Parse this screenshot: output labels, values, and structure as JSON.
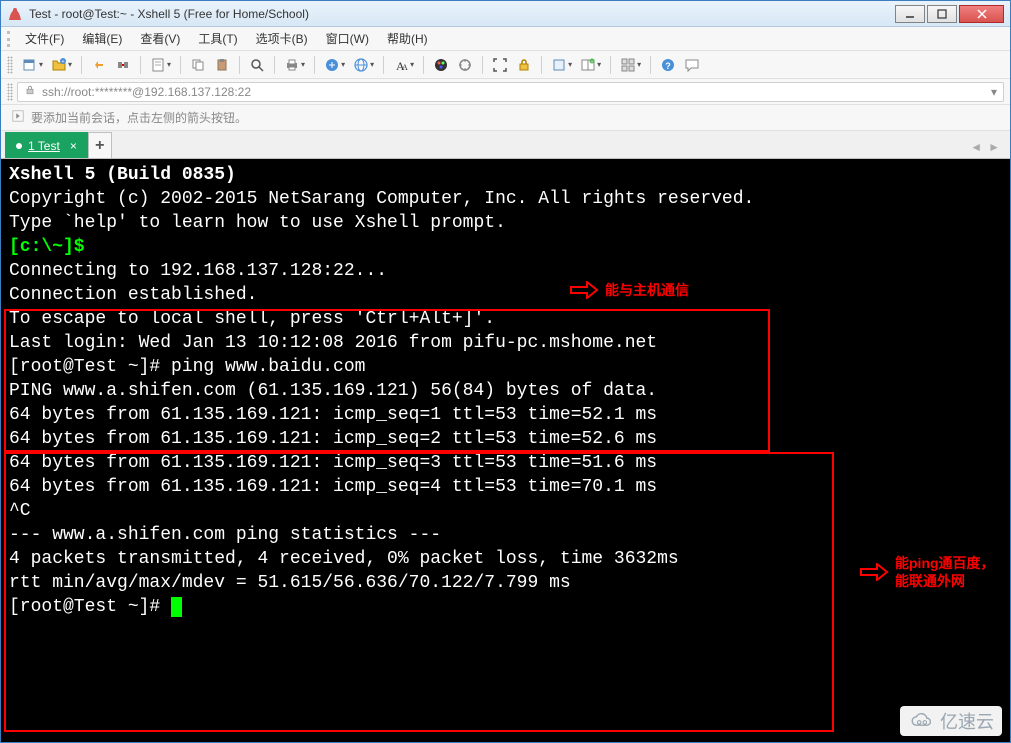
{
  "window": {
    "title": "Test - root@Test:~ - Xshell 5 (Free for Home/School)"
  },
  "menu": {
    "file": "文件(F)",
    "edit": "编辑(E)",
    "view": "查看(V)",
    "tools": "工具(T)",
    "tab": "选项卡(B)",
    "window": "窗口(W)",
    "help": "帮助(H)"
  },
  "address": {
    "url": "ssh://root:********@192.168.137.128:22"
  },
  "infobar": {
    "hint": "要添加当前会话，点击左侧的箭头按钮。"
  },
  "tabs": {
    "active": "1 Test",
    "add": "+"
  },
  "terminal": {
    "l0": "Xshell 5 (Build 0835)",
    "l1": "Copyright (c) 2002-2015 NetSarang Computer, Inc. All rights reserved.",
    "l2": "",
    "l3": "Type `help' to learn how to use Xshell prompt.",
    "l4_prompt": "[c:\\~]$",
    "l5": "",
    "l6": "Connecting to 192.168.137.128:22...",
    "l7": "Connection established.",
    "l8": "To escape to local shell, press 'Ctrl+Alt+]'.",
    "l9": "",
    "l10": "Last login: Wed Jan 13 10:12:08 2016 from pifu-pc.mshome.net",
    "l11": "[root@Test ~]# ping www.baidu.com",
    "l12": "PING www.a.shifen.com (61.135.169.121) 56(84) bytes of data.",
    "l13": "64 bytes from 61.135.169.121: icmp_seq=1 ttl=53 time=52.1 ms",
    "l14": "64 bytes from 61.135.169.121: icmp_seq=2 ttl=53 time=52.6 ms",
    "l15": "64 bytes from 61.135.169.121: icmp_seq=3 ttl=53 time=51.6 ms",
    "l16": "64 bytes from 61.135.169.121: icmp_seq=4 ttl=53 time=70.1 ms",
    "l17": "^C",
    "l18": "--- www.a.shifen.com ping statistics ---",
    "l19": "4 packets transmitted, 4 received, 0% packet loss, time 3632ms",
    "l20": "rtt min/avg/max/mdev = 51.615/56.636/70.122/7.799 ms",
    "l21": "[root@Test ~]# "
  },
  "annotations": {
    "a1": "能与主机通信",
    "a2_line1": "能ping通百度，",
    "a2_line2": "能联通外网"
  },
  "watermark": {
    "text": "亿速云"
  },
  "icons": {
    "minimize": "minimize-icon",
    "maximize": "maximize-icon",
    "close": "close-icon"
  }
}
